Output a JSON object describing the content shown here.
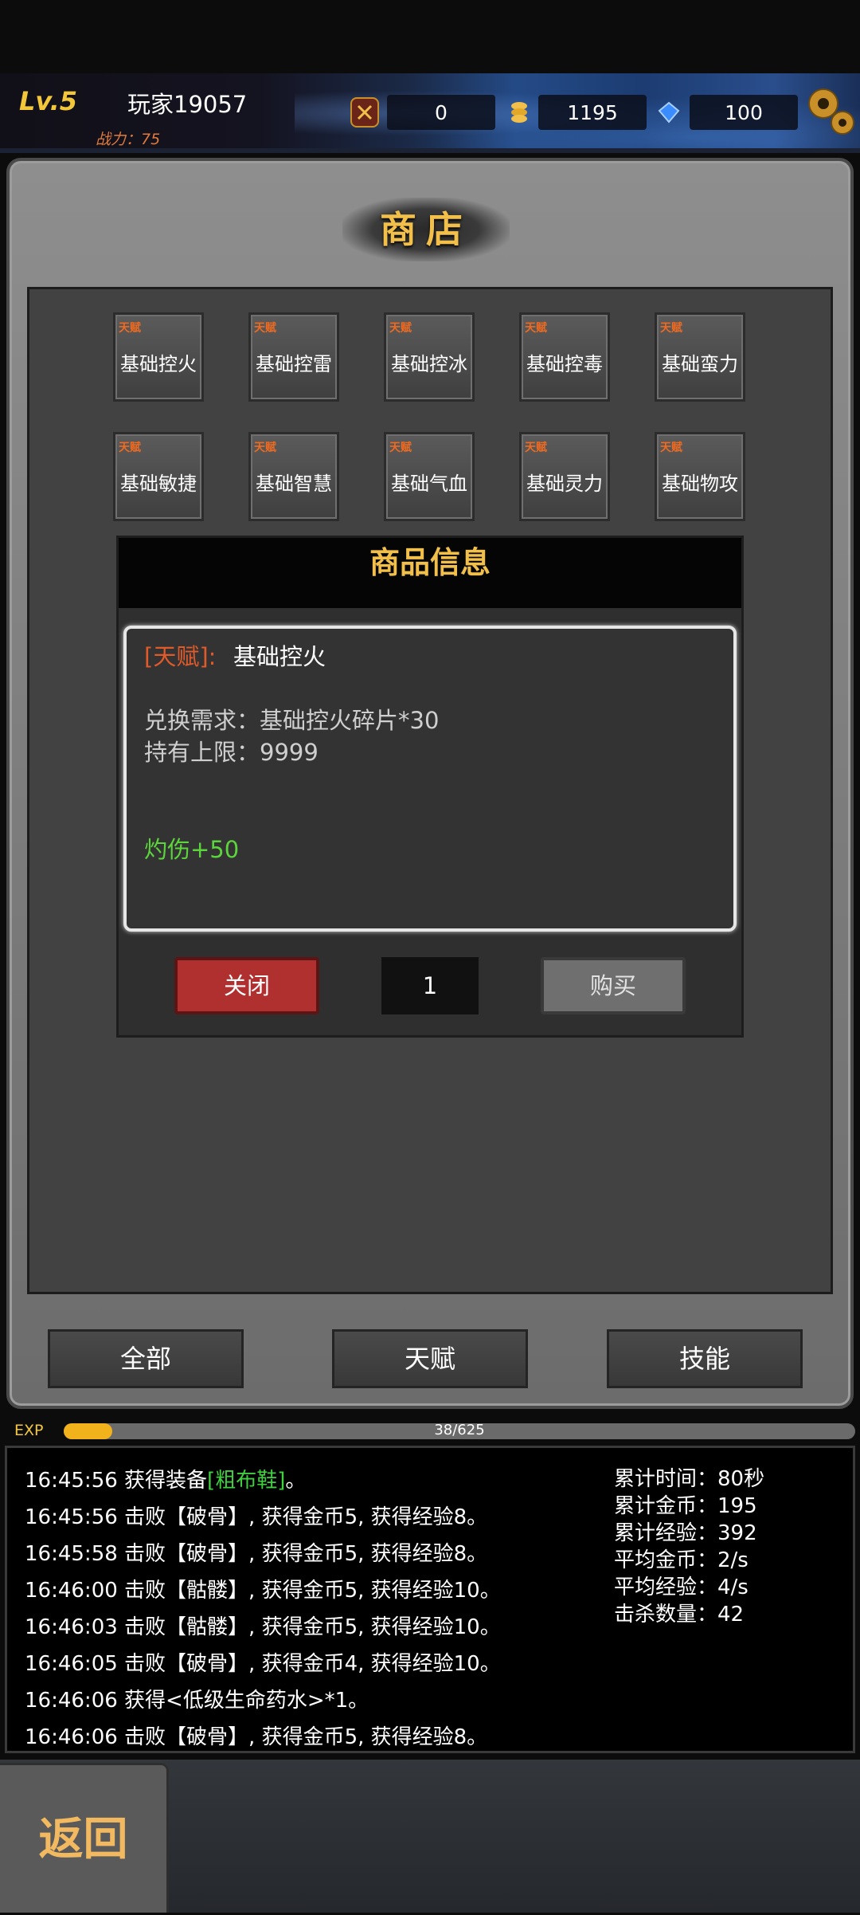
{
  "header": {
    "level": "Lv.5",
    "player_name": "玩家19057",
    "combat_power": "战力：75",
    "resources": [
      {
        "icon": "sword-coin-icon",
        "value": "0"
      },
      {
        "icon": "gold-coin-icon",
        "value": "1195"
      },
      {
        "icon": "blue-gem-icon",
        "value": "100"
      }
    ],
    "settings_icon": "gear-icon"
  },
  "shop": {
    "title": "商店",
    "item_tag": "天赋",
    "items": [
      "基础控火",
      "基础控雷",
      "基础控冰",
      "基础控毒",
      "基础蛮力",
      "基础敏捷",
      "基础智慧",
      "基础气血",
      "基础灵力",
      "基础物攻"
    ]
  },
  "modal": {
    "title": "商品信息",
    "type_label": "[天赋]:",
    "item_name": "基础控火",
    "requirement": "兑换需求：基础控火碎片*30",
    "limit": "持有上限：9999",
    "effect": "灼伤+50",
    "close_label": "关闭",
    "quantity": "1",
    "buy_label": "购买"
  },
  "categories": [
    "全部",
    "天赋",
    "技能"
  ],
  "exp": {
    "label": "EXP",
    "text": "38/625",
    "fraction": 0.061
  },
  "log": {
    "lines": [
      {
        "prefix": "16:45:56 获得装备",
        "highlight": "[粗布鞋]",
        "suffix": "。"
      },
      {
        "prefix": "16:45:56 击败【破骨】, 获得金币5, 获得经验8。",
        "highlight": "",
        "suffix": ""
      },
      {
        "prefix": "16:45:58 击败【破骨】, 获得金币5, 获得经验8。",
        "highlight": "",
        "suffix": ""
      },
      {
        "prefix": "16:46:00 击败【骷髅】, 获得金币5, 获得经验10。",
        "highlight": "",
        "suffix": ""
      },
      {
        "prefix": "16:46:03 击败【骷髅】, 获得金币5, 获得经验10。",
        "highlight": "",
        "suffix": ""
      },
      {
        "prefix": "16:46:05 击败【破骨】, 获得金币4, 获得经验10。",
        "highlight": "",
        "suffix": ""
      },
      {
        "prefix": "16:46:06 获得<低级生命药水>*1。",
        "highlight": "",
        "suffix": ""
      },
      {
        "prefix": "16:46:06 击败【破骨】, 获得金币5, 获得经验8。",
        "highlight": "",
        "suffix": ""
      }
    ],
    "stats": [
      "累计时间：80秒",
      "累计金币：195",
      "累计经验：392",
      "平均金币：2/s",
      "平均经验：4/s",
      "击杀数量：42"
    ]
  },
  "footer": {
    "back_label": "返回"
  }
}
